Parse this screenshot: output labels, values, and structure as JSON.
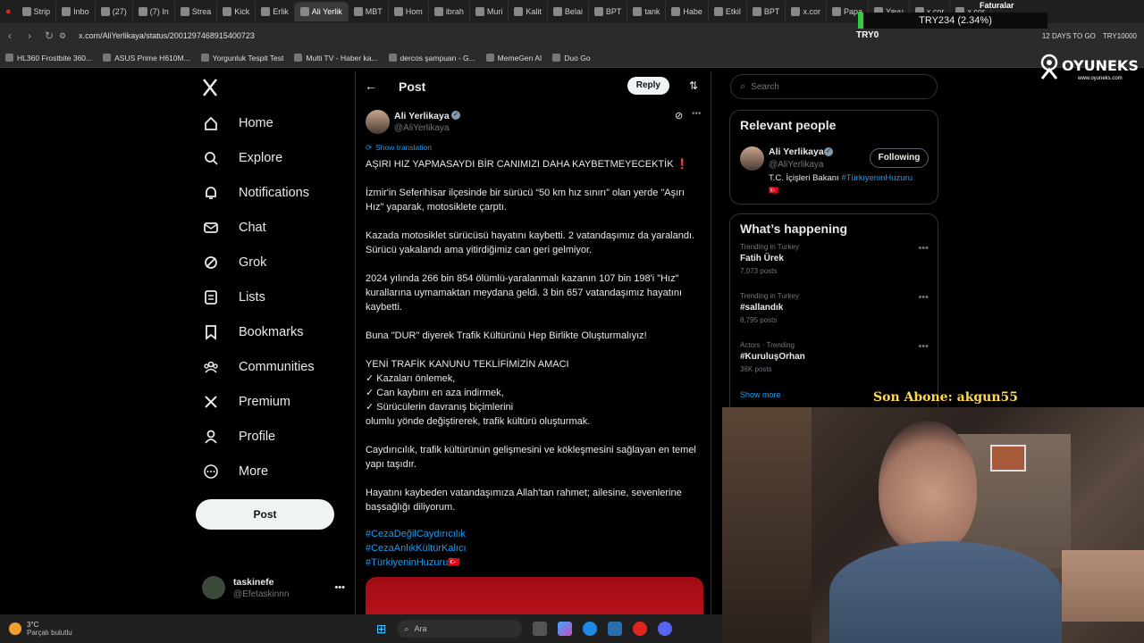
{
  "browser": {
    "tabs": [
      {
        "label": "Strip",
        "active": false
      },
      {
        "label": "Inbo",
        "active": false
      },
      {
        "label": "(27)",
        "active": false
      },
      {
        "label": "(7) In",
        "active": false
      },
      {
        "label": "Strea",
        "active": false
      },
      {
        "label": "Kick",
        "active": false
      },
      {
        "label": "Erlik",
        "active": false
      },
      {
        "label": "Ali Yerlik",
        "active": true
      },
      {
        "label": "MBT",
        "active": false
      },
      {
        "label": "Hom",
        "active": false
      },
      {
        "label": "ibrah",
        "active": false
      },
      {
        "label": "Muri",
        "active": false
      },
      {
        "label": "Kalit",
        "active": false
      },
      {
        "label": "Belai",
        "active": false
      },
      {
        "label": "BPT",
        "active": false
      },
      {
        "label": "tank",
        "active": false
      },
      {
        "label": "Habe",
        "active": false
      },
      {
        "label": "Etkil",
        "active": false
      },
      {
        "label": "BPT",
        "active": false
      },
      {
        "label": "x.cor",
        "active": false
      },
      {
        "label": "Papa",
        "active": false
      },
      {
        "label": "Yavu",
        "active": false
      },
      {
        "label": "x.cor",
        "active": false
      },
      {
        "label": "x.cor",
        "active": false
      }
    ],
    "url": "x.com/AliYerlikaya/status/2001297468915400723",
    "bookmarks": [
      "HL360 Frostbite 360...",
      "ASUS Prime H610M...",
      "Yorgunluk Tespit Test",
      "Multi TV - Haber ka...",
      "dercos şampuan - G...",
      "MemeGen AI",
      "Duo Go"
    ],
    "faturalar": "Faturalar",
    "days_label": "12 DAYS TO GO",
    "try_short": "TRY10000"
  },
  "overlay": {
    "ticker": "TRY234 (2.34%)",
    "ticker_name": "TRY0",
    "logo": "OYUNEKS",
    "logo_url": "www.oyuneks.com",
    "son_abone": "Son Abone: akgun55"
  },
  "sidebar": {
    "items": [
      {
        "label": "Home",
        "icon": "home-icon"
      },
      {
        "label": "Explore",
        "icon": "search-icon"
      },
      {
        "label": "Notifications",
        "icon": "bell-icon"
      },
      {
        "label": "Chat",
        "icon": "mail-icon"
      },
      {
        "label": "Grok",
        "icon": "grok-icon"
      },
      {
        "label": "Lists",
        "icon": "list-icon"
      },
      {
        "label": "Bookmarks",
        "icon": "bookmark-icon"
      },
      {
        "label": "Communities",
        "icon": "communities-icon"
      },
      {
        "label": "Premium",
        "icon": "x-icon"
      },
      {
        "label": "Profile",
        "icon": "person-icon"
      },
      {
        "label": "More",
        "icon": "more-circle-icon"
      }
    ],
    "post_button": "Post",
    "account": {
      "name": "taskinefe",
      "handle": "@Efetaskinnn"
    }
  },
  "post": {
    "header_title": "Post",
    "reply_button": "Reply",
    "author_name": "Ali Yerlikaya",
    "author_handle": "@AliYerlikaya",
    "show_translation": "Show translation",
    "paragraphs": [
      "AŞIRI HIZ YAPMASAYDI BİR CANIMIZI DAHA KAYBETMEYECEKTİK ❗",
      "İzmir'in Seferihisar ilçesinde bir sürücü “50 km hız sınırı” olan yerde \"Aşırı Hız\" yaparak, motosiklete çarptı.",
      "Kazada motosiklet sürücüsü hayatını kaybetti. 2 vatandaşımız da yaralandı. Sürücü yakalandı ama yitirdiğimiz can geri gelmiyor.",
      "2024 yılında 266 bin 854 ölümlü-yaralanmalı kazanın 107 bin 198'i \"Hız\" kurallarına uymamaktan meydana geldi. 3 bin 657 vatandaşımız hayatını kaybetti.",
      "Buna \"DUR\" diyerek Trafik Kültürünü Hep Birlikte Oluşturmalıyız!",
      "YENİ TRAFİK KANUNU TEKLİFİMİZİN AMACI\n✓ Kazaları önlemek,\n✓ Can kaybını en aza indirmek,\n✓ Sürücülerin davranış biçimlerini\nolumlu yönde değiştirerek, trafik kültürü oluşturmak.",
      "Caydırıcılık, trafik kültürünün gelişmesini ve kökleşmesini sağlayan en temel yapı taşıdır.",
      "Hayatını kaybeden vatandaşımıza Allah'tan rahmet; ailesine, sevenlerine başsağlığı diliyorum."
    ],
    "hashtags": [
      "#CezaDeğilCaydırıcılık",
      "#CezaAnlıkKültürKalıcı",
      "#TürkiyeninHuzuru🇹🇷"
    ]
  },
  "right": {
    "search_placeholder": "Search",
    "relevant_title": "Relevant people",
    "person": {
      "name": "Ali Yerlikaya",
      "handle": "@AliYerlikaya",
      "button": "Following",
      "bio": "T.C. İçişleri Bakanı",
      "bio_link": "#TürkiyeninHuzuru",
      "flag": "🇹🇷"
    },
    "happening_title": "What’s happening",
    "trends": [
      {
        "meta": "Trending in Turkey",
        "name": "Fatih Ürek",
        "count": "7,073 posts"
      },
      {
        "meta": "Trending in Turkey",
        "name": "#sallandık",
        "count": "8,795 posts"
      },
      {
        "meta": "Actors · Trending",
        "name": "#KuruluşOrhan",
        "count": "36K posts"
      }
    ],
    "show_more": "Show more"
  },
  "taskbar": {
    "weather_temp": "3°C",
    "weather_desc": "Parçalı bulutlu",
    "search_label": "Ara"
  },
  "colors": {
    "accent": "#1d9bf0",
    "background": "#000000",
    "ticker_green": "#2ecc40"
  }
}
